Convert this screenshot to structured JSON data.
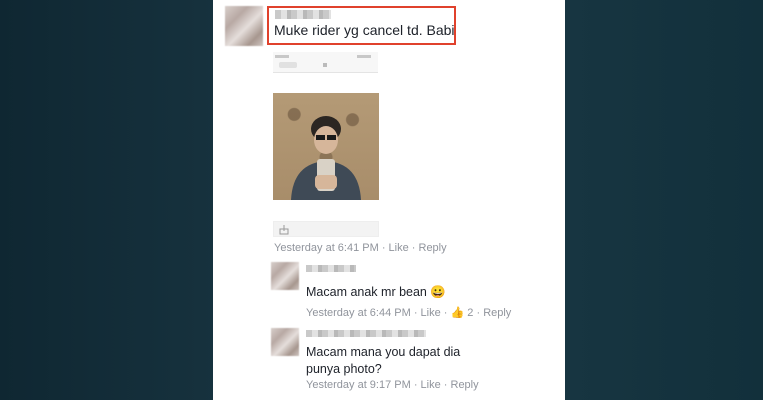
{
  "post": {
    "text": "Muke rider yg cancel td. Babi",
    "meta": "Yesterday at 6:41 PM · Like · Reply"
  },
  "replies": [
    {
      "text": "Macam anak mr bean",
      "emoji": "😀",
      "meta_time": "Yesterday at 6:44 PM · Like ·",
      "like_count": "2",
      "meta_tail": "· Reply"
    },
    {
      "text": "Macam mana you dapat dia punya photo?",
      "meta": "Yesterday at 9:17 PM · Like · Reply"
    }
  ],
  "colors": {
    "highlight": "#e0412c",
    "meta": "#90949c",
    "text": "#1d2129"
  }
}
